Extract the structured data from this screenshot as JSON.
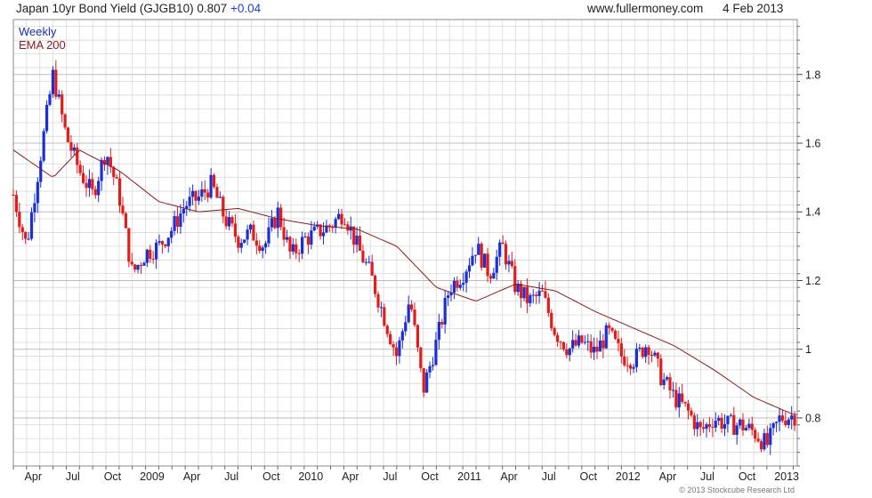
{
  "header": {
    "title": "Japan 10yr Bond Yield (GJGB10)",
    "last_value": "0.807",
    "change": "+0.04",
    "site": "www.fullermoney.com",
    "date": "4 Feb 2013"
  },
  "legend": {
    "series1": "Weekly",
    "series2": "EMA 200"
  },
  "copyright": "© 2013 Stockcube Research Ltd",
  "colors": {
    "up": "#1a2fd6",
    "down": "#e21b1b",
    "ema": "#8b1a1a",
    "grid": "#d8d8d8",
    "legend_weekly": "#1a2fb0",
    "legend_ema": "#8b1a1a"
  },
  "chart_data": {
    "type": "candlestick",
    "frequency": "weekly",
    "x_ticks": [
      "Apr",
      "Jul",
      "Oct",
      "2009",
      "Apr",
      "Jul",
      "Oct",
      "2010",
      "Apr",
      "Jul",
      "Oct",
      "2011",
      "Apr",
      "Jul",
      "Oct",
      "2012",
      "Apr",
      "Jul",
      "Oct",
      "2013"
    ],
    "y_ticks": [
      0.8,
      1.0,
      1.2,
      1.4,
      1.6,
      1.8
    ],
    "ylim": [
      0.66,
      1.96
    ],
    "grid": true,
    "legend_position": "top-left",
    "close_path": [
      [
        "2008-03",
        1.45
      ],
      [
        "2008-04",
        1.3
      ],
      [
        "2008-05",
        1.55
      ],
      [
        "2008-06",
        1.8
      ],
      [
        "2008-07",
        1.62
      ],
      [
        "2008-08",
        1.52
      ],
      [
        "2008-09",
        1.45
      ],
      [
        "2008-10",
        1.58
      ],
      [
        "2008-11",
        1.45
      ],
      [
        "2008-12",
        1.22
      ],
      [
        "2009-01",
        1.28
      ],
      [
        "2009-02",
        1.3
      ],
      [
        "2009-03",
        1.35
      ],
      [
        "2009-04",
        1.42
      ],
      [
        "2009-05",
        1.44
      ],
      [
        "2009-06",
        1.48
      ],
      [
        "2009-07",
        1.38
      ],
      [
        "2009-08",
        1.32
      ],
      [
        "2009-09",
        1.34
      ],
      [
        "2009-10",
        1.3
      ],
      [
        "2009-11",
        1.4
      ],
      [
        "2009-12",
        1.27
      ],
      [
        "2010-01",
        1.32
      ],
      [
        "2010-02",
        1.34
      ],
      [
        "2010-03",
        1.36
      ],
      [
        "2010-04",
        1.4
      ],
      [
        "2010-05",
        1.3
      ],
      [
        "2010-06",
        1.22
      ],
      [
        "2010-07",
        1.1
      ],
      [
        "2010-08",
        0.98
      ],
      [
        "2010-09",
        1.15
      ],
      [
        "2010-10",
        0.88
      ],
      [
        "2010-11",
        1.02
      ],
      [
        "2010-12",
        1.18
      ],
      [
        "2011-01",
        1.22
      ],
      [
        "2011-02",
        1.3
      ],
      [
        "2011-03",
        1.22
      ],
      [
        "2011-04",
        1.3
      ],
      [
        "2011-05",
        1.18
      ],
      [
        "2011-06",
        1.14
      ],
      [
        "2011-07",
        1.16
      ],
      [
        "2011-08",
        1.05
      ],
      [
        "2011-09",
        1.0
      ],
      [
        "2011-10",
        1.02
      ],
      [
        "2011-11",
        0.99
      ],
      [
        "2011-12",
        1.05
      ],
      [
        "2012-01",
        0.98
      ],
      [
        "2012-02",
        0.97
      ],
      [
        "2012-03",
        1.02
      ],
      [
        "2012-04",
        0.92
      ],
      [
        "2012-05",
        0.86
      ],
      [
        "2012-06",
        0.82
      ],
      [
        "2012-07",
        0.76
      ],
      [
        "2012-08",
        0.8
      ],
      [
        "2012-09",
        0.78
      ],
      [
        "2012-10",
        0.78
      ],
      [
        "2012-11",
        0.76
      ],
      [
        "2012-12",
        0.72
      ],
      [
        "2013-01",
        0.8
      ],
      [
        "2013-02",
        0.807
      ]
    ],
    "ema_path": [
      [
        "2008-03",
        1.58
      ],
      [
        "2008-06",
        1.5
      ],
      [
        "2008-08",
        1.58
      ],
      [
        "2008-11",
        1.52
      ],
      [
        "2009-02",
        1.43
      ],
      [
        "2009-05",
        1.4
      ],
      [
        "2009-08",
        1.41
      ],
      [
        "2009-11",
        1.38
      ],
      [
        "2010-02",
        1.36
      ],
      [
        "2010-05",
        1.35
      ],
      [
        "2010-08",
        1.3
      ],
      [
        "2010-11",
        1.18
      ],
      [
        "2011-02",
        1.14
      ],
      [
        "2011-05",
        1.19
      ],
      [
        "2011-08",
        1.17
      ],
      [
        "2011-11",
        1.11
      ],
      [
        "2012-02",
        1.06
      ],
      [
        "2012-05",
        1.01
      ],
      [
        "2012-08",
        0.94
      ],
      [
        "2012-11",
        0.86
      ],
      [
        "2013-02",
        0.81
      ]
    ]
  }
}
